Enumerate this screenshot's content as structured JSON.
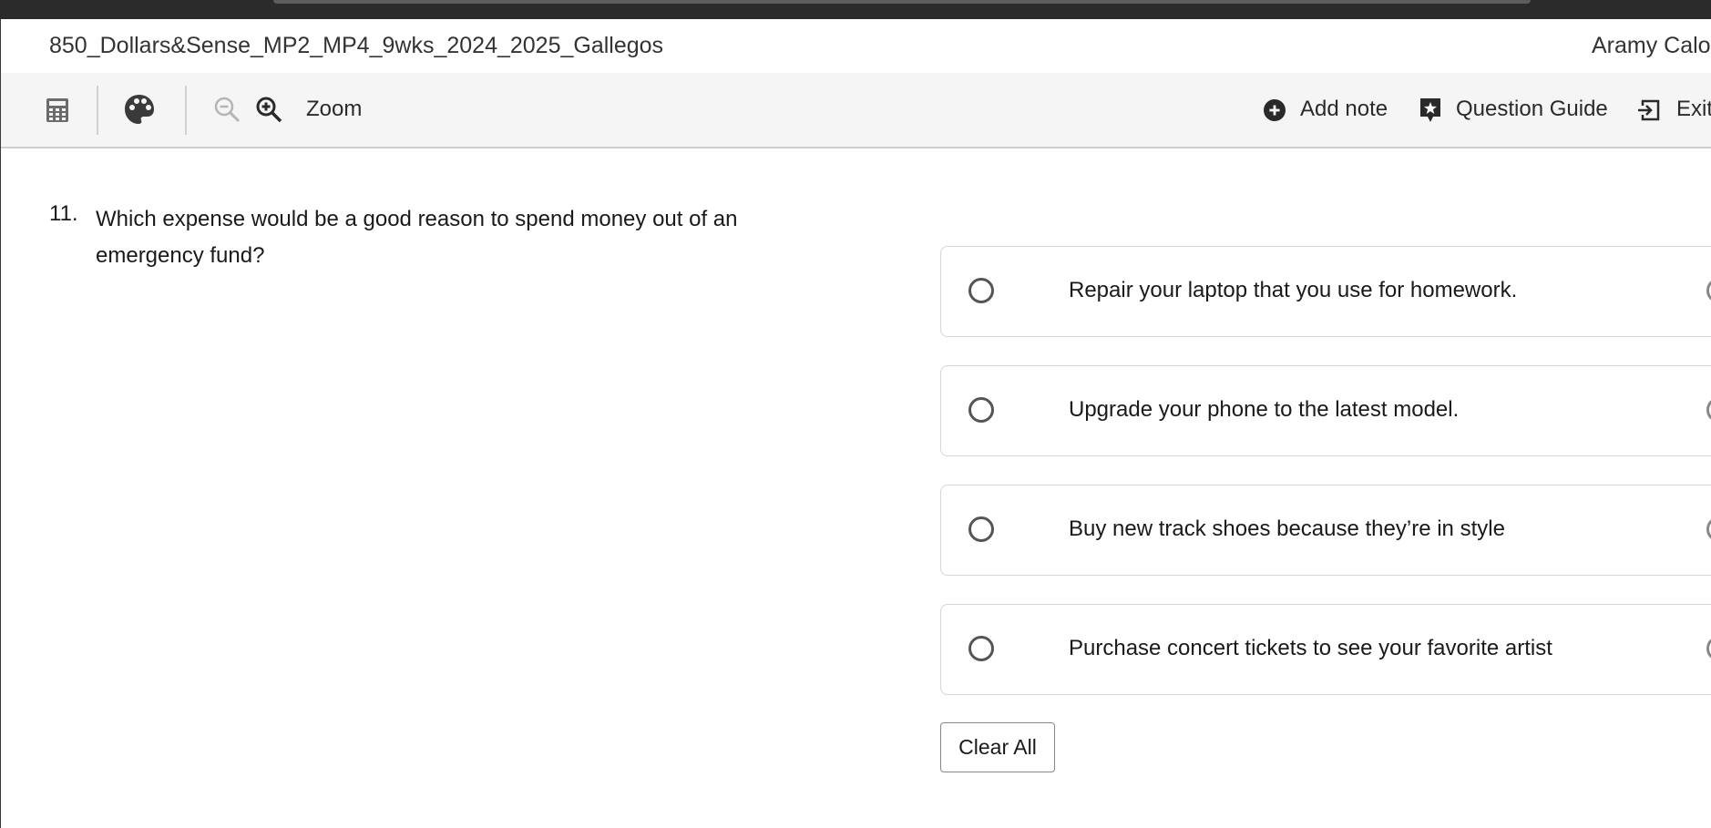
{
  "header": {
    "test_title": "850_Dollars&Sense_MP2_MP4_9wks_2024_2025_Gallegos",
    "user_name": "Aramy Calo"
  },
  "toolbar": {
    "tools": [
      {
        "icon": "calculator-icon"
      },
      {
        "icon": "palette-icon"
      },
      {
        "icon": "zoom-out-icon"
      },
      {
        "icon": "zoom-in-icon"
      }
    ],
    "zoom_label": "Zoom",
    "add_note_label": "Add note",
    "question_guide_label": "Question Guide",
    "exit_label": "Exit"
  },
  "question": {
    "number": "11.",
    "text": "Which expense would be a good reason to spend money out of an emergency fund?",
    "options": [
      {
        "label": "Repair your laptop that you use for homework."
      },
      {
        "label": "Upgrade your phone to the latest model."
      },
      {
        "label": "Buy new track shoes because they’re in style"
      },
      {
        "label": "Purchase concert tickets to see your favorite artist"
      }
    ],
    "clear_label": "Clear All"
  },
  "colors": {
    "toolbar_bg": "#f5f5f5",
    "top_bar": "#2b2b2b",
    "icon": "#333333",
    "disabled_icon": "#b5b5b5"
  }
}
